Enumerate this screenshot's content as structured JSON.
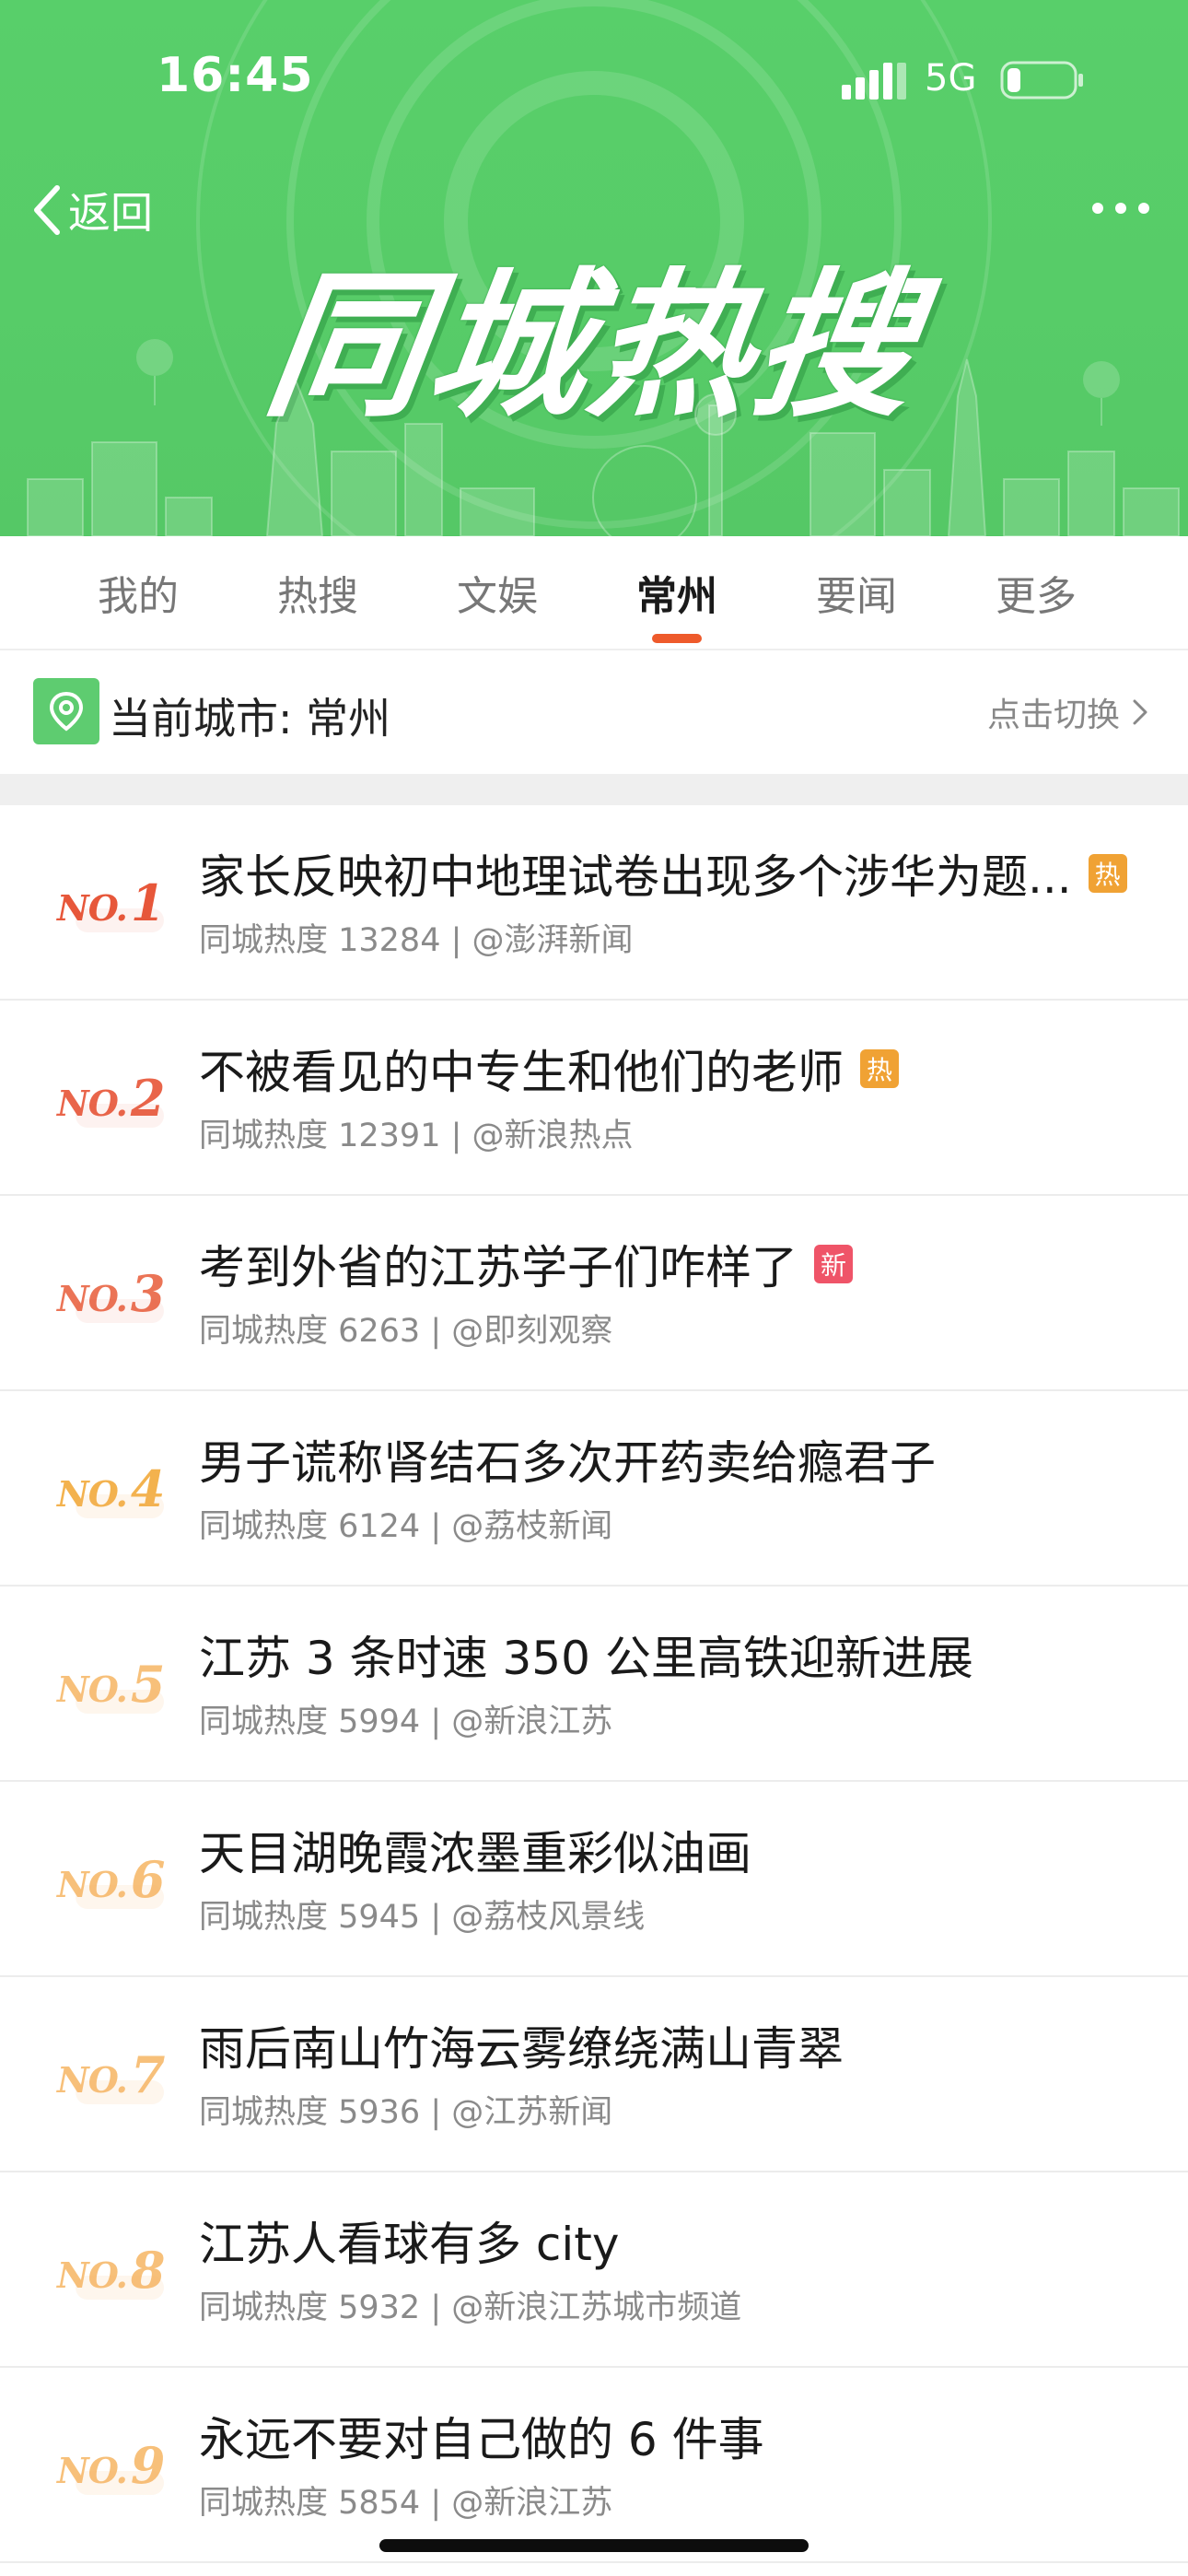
{
  "status_bar": {
    "time": "16:45",
    "network": "5G"
  },
  "header": {
    "back_label": "返回",
    "banner_title": "同城热搜"
  },
  "tabs": [
    {
      "label": "我的"
    },
    {
      "label": "热搜"
    },
    {
      "label": "文娱"
    },
    {
      "label": "常州",
      "active": true
    },
    {
      "label": "要闻"
    },
    {
      "label": "更多"
    }
  ],
  "city": {
    "label": "当前城市: 常州",
    "switch_label": "点击切换"
  },
  "list": [
    {
      "rank": "1",
      "no_label": "NO.",
      "title": "家长反映初中地理试卷出现多个涉华为题...",
      "badge": "热",
      "meta": "同城热度 13284 | @澎湃新闻"
    },
    {
      "rank": "2",
      "no_label": "NO.",
      "title": "不被看见的中专生和他们的老师",
      "badge": "热",
      "meta": "同城热度 12391 | @新浪热点"
    },
    {
      "rank": "3",
      "no_label": "NO.",
      "title": "考到外省的江苏学子们咋样了",
      "badge": "新",
      "meta": "同城热度 6263 | @即刻观察"
    },
    {
      "rank": "4",
      "no_label": "NO.",
      "title": "男子谎称肾结石多次开药卖给瘾君子",
      "badge": "",
      "meta": "同城热度 6124 | @荔枝新闻"
    },
    {
      "rank": "5",
      "no_label": "NO.",
      "title": "江苏 3 条时速 350 公里高铁迎新进展",
      "badge": "",
      "meta": "同城热度 5994 | @新浪江苏"
    },
    {
      "rank": "6",
      "no_label": "NO.",
      "title": "天目湖晚霞浓墨重彩似油画",
      "badge": "",
      "meta": "同城热度 5945 | @荔枝风景线"
    },
    {
      "rank": "7",
      "no_label": "NO.",
      "title": "雨后南山竹海云雾缭绕满山青翠",
      "badge": "",
      "meta": "同城热度 5936 | @江苏新闻"
    },
    {
      "rank": "8",
      "no_label": "NO.",
      "title": "江苏人看球有多 city",
      "badge": "",
      "meta": "同城热度 5932 | @新浪江苏城市频道"
    },
    {
      "rank": "9",
      "no_label": "NO.",
      "title": "永远不要对自己做的 6 件事",
      "badge": "",
      "meta": "同城热度 5854 | @新浪江苏"
    }
  ],
  "colors": {
    "header_green": "#57cc68",
    "tab_indicator": "#ee5a2b",
    "badge_hot": "#f0a234",
    "badge_new": "#ef5468",
    "rank_top": "#e7573a",
    "rank_rest": "#f7c07a"
  },
  "icons": {
    "back": "chevron-left-icon",
    "more": "more-dots-icon",
    "city": "location-pin-icon",
    "switch": "chevron-right-icon"
  }
}
